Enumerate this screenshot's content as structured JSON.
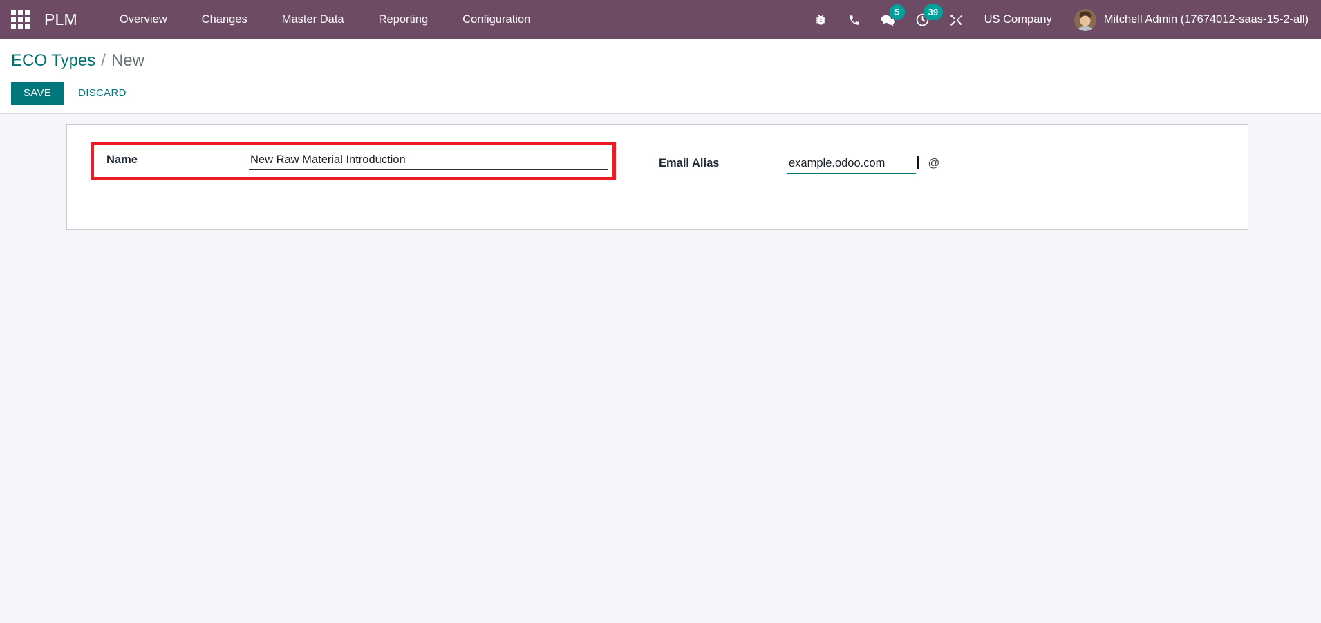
{
  "navbar": {
    "apps_icon": "apps-grid-icon",
    "brand": "PLM",
    "menu": [
      {
        "label": "Overview"
      },
      {
        "label": "Changes"
      },
      {
        "label": "Master Data"
      },
      {
        "label": "Reporting"
      },
      {
        "label": "Configuration"
      }
    ],
    "systray": [
      {
        "icon": "bug-icon",
        "badge": null
      },
      {
        "icon": "phone-icon",
        "badge": null
      },
      {
        "icon": "messages-icon",
        "badge": "5"
      },
      {
        "icon": "activities-clock-icon",
        "badge": "39"
      },
      {
        "icon": "tools-icon",
        "badge": null
      }
    ],
    "company": "US Company",
    "user": "Mitchell Admin (17674012-saas-15-2-all)",
    "colors": {
      "navbar_bg": "#6d4b65",
      "badge_bg": "#00a09d"
    }
  },
  "control_panel": {
    "breadcrumb": {
      "root": "ECO Types",
      "separator": "/",
      "current": "New"
    },
    "buttons": {
      "save": "SAVE",
      "discard": "DISCARD"
    },
    "colors": {
      "primary": "#00787b",
      "link": "#00706e"
    }
  },
  "form": {
    "name_field": {
      "label": "Name",
      "value": "New Raw Material Introduction",
      "placeholder": "",
      "highlight_color": "#ed1c24"
    },
    "email_alias_field": {
      "label": "Email Alias",
      "value": "example.odoo.com",
      "placeholder": "",
      "suffix": "@"
    }
  }
}
